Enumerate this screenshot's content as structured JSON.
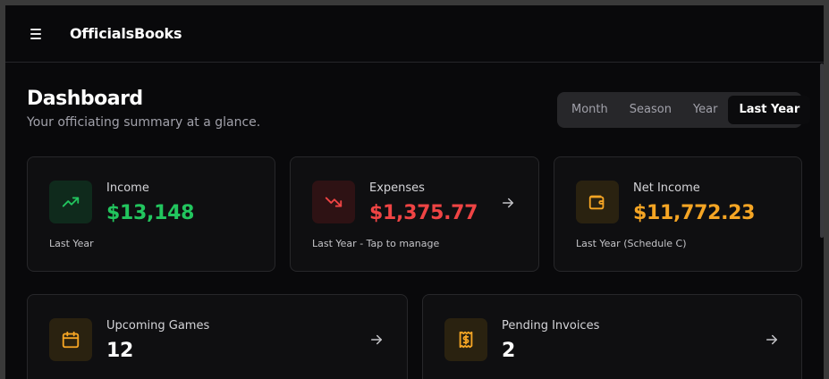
{
  "app": {
    "brand": "OfficialsBooks"
  },
  "header": {
    "title": "Dashboard",
    "subtitle": "Your officiating summary at a glance."
  },
  "period_filter": {
    "options": [
      "Month",
      "Season",
      "Year",
      "Last Year"
    ],
    "selected": "Last Year"
  },
  "cards": {
    "income": {
      "label": "Income",
      "value": "$13,148",
      "footnote": "Last Year",
      "icon": "trending-up-icon",
      "color": "#22c55e"
    },
    "expenses": {
      "label": "Expenses",
      "value": "$1,375.77",
      "footnote": "Last Year - Tap to manage",
      "icon": "trending-down-icon",
      "color": "#ef4444"
    },
    "net_income": {
      "label": "Net Income",
      "value": "$11,772.23",
      "footnote": "Last Year (Schedule C)",
      "icon": "wallet-icon",
      "color": "#f5a524"
    },
    "upcoming_games": {
      "label": "Upcoming Games",
      "value": "12",
      "icon": "calendar-icon",
      "color": "#f5a524"
    },
    "pending_invoices": {
      "label": "Pending Invoices",
      "value": "2",
      "icon": "receipt-icon",
      "color": "#f5a524"
    }
  }
}
